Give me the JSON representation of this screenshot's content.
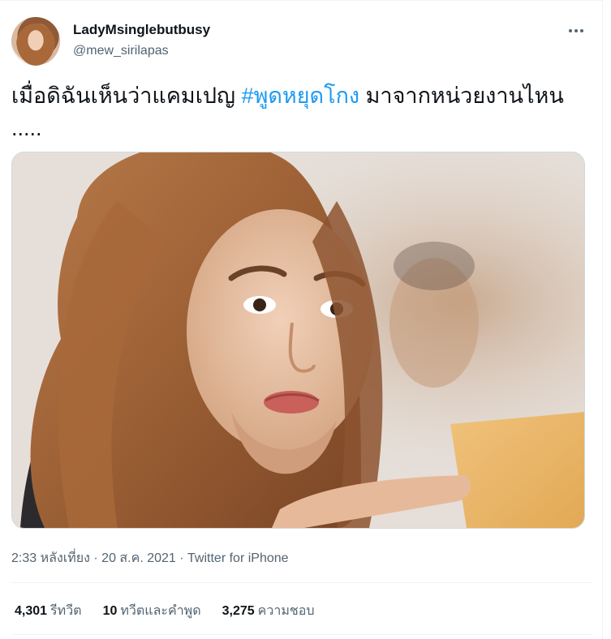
{
  "author": {
    "display_name": "LadyMsinglebutbusy",
    "handle": "@mew_sirilapas"
  },
  "tweet": {
    "text_before": "เมื่อดิฉันเห็นว่าแคมเปญ ",
    "hashtag": "#พูดหยุดโกง",
    "text_after": " มาจากหน่วยงานไหน",
    "text_line2": "....."
  },
  "meta": {
    "time": "2:33 หลังเที่ยง",
    "sep1": " · ",
    "date": "20 ส.ค. 2021",
    "sep2": " · ",
    "source": "Twitter for iPhone"
  },
  "stats": {
    "retweets_count": "4,301",
    "retweets_label": "รีทวีต",
    "quotes_count": "10",
    "quotes_label": "ทวีตและคำพูด",
    "likes_count": "3,275",
    "likes_label": "ความชอบ"
  },
  "colors": {
    "accent": "#1d9bf0",
    "text_primary": "#0f1419",
    "text_secondary": "#536471",
    "border": "#eff3f4"
  },
  "icons": {
    "more": "more-horizontal-icon"
  }
}
